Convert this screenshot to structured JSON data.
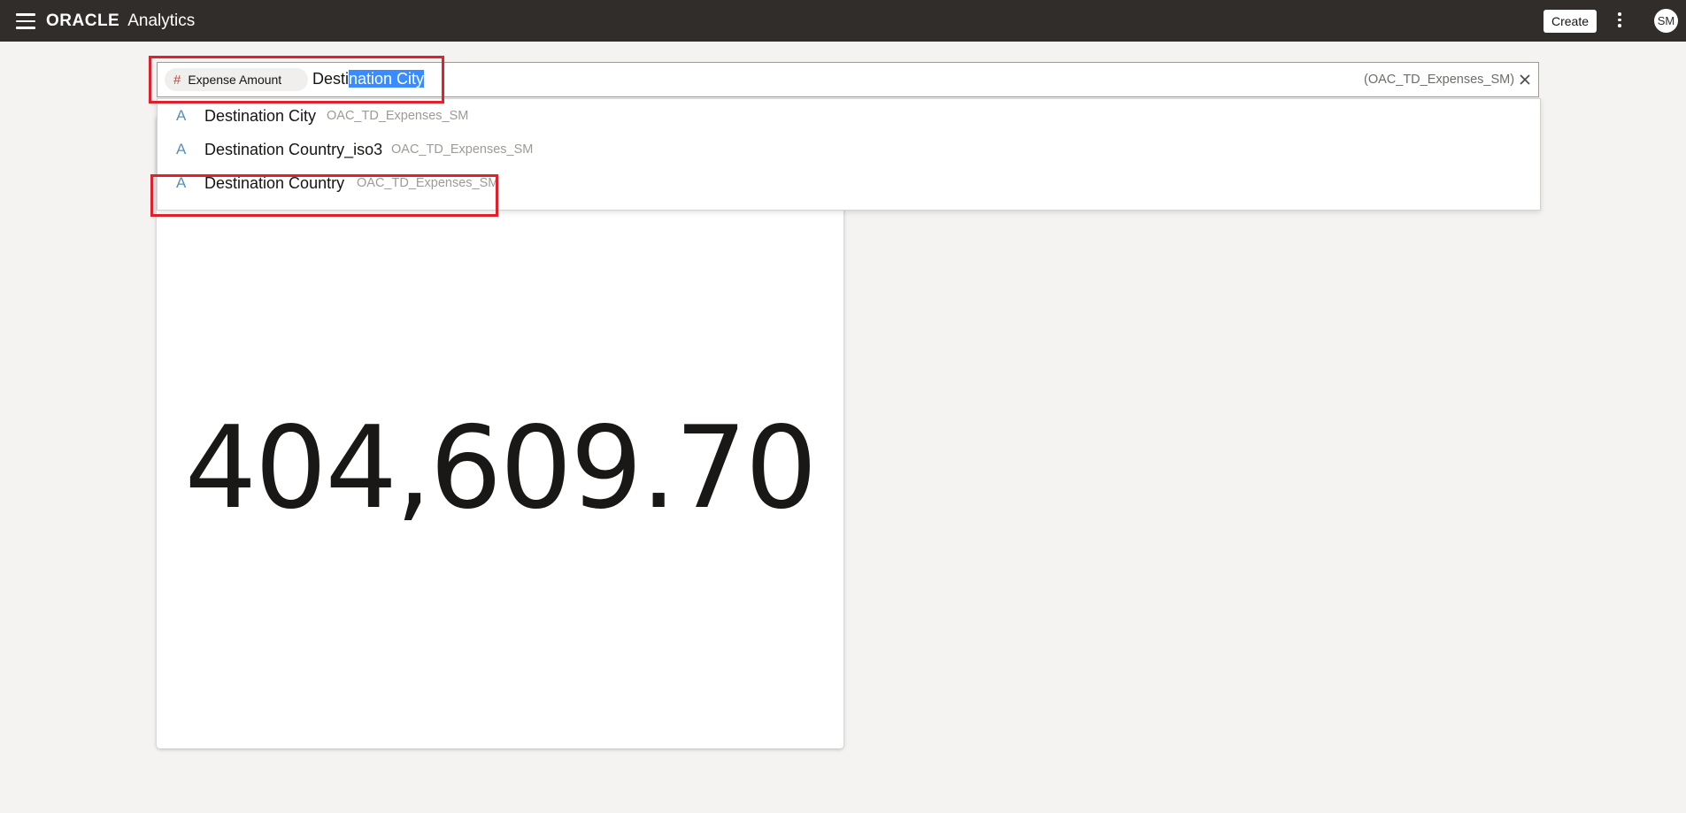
{
  "app": {
    "logo_text": "ORACLE",
    "product_name": "Analytics",
    "create_label": "Create",
    "avatar_initials": "SM"
  },
  "search": {
    "chip_icon": "#",
    "chip_label": "Expense Amount",
    "typed_prefix": "Desti",
    "selected_suffix": "nation City",
    "subject_area": "(OAC_TD_Expenses_SM)",
    "clear_icon": "close-icon"
  },
  "suggestions": [
    {
      "type_icon": "A",
      "label": "Destination City",
      "source": "OAC_TD_Expenses_SM"
    },
    {
      "type_icon": "A",
      "label": "Destination Country_iso3",
      "source": "OAC_TD_Expenses_SM"
    },
    {
      "type_icon": "A",
      "label": "Destination Country",
      "source": "OAC_TD_Expenses_SM"
    }
  ],
  "visualization": {
    "kpi_value": "404,609.70"
  },
  "colors": {
    "header_bg": "#312d2a",
    "selection": "#3a8bff",
    "measure_icon": "#c74634",
    "attribute_icon": "#5b8fb9",
    "annotation_red": "#e0202a"
  }
}
